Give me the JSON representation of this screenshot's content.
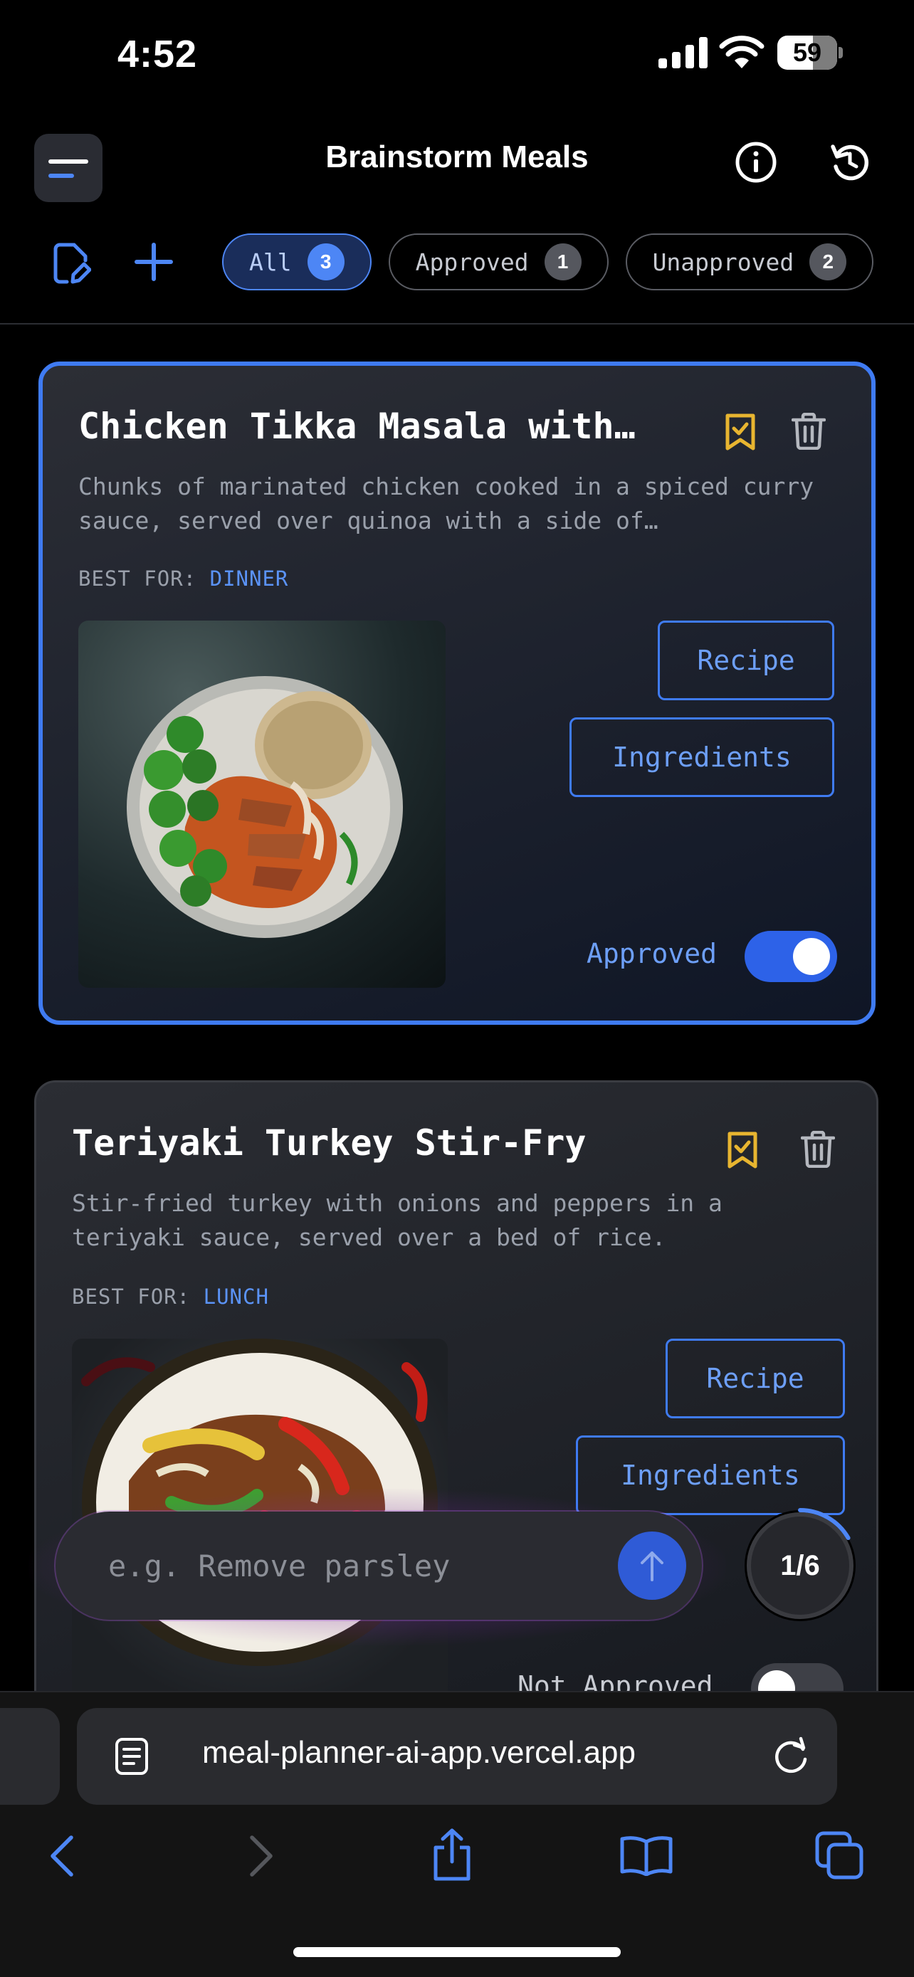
{
  "status_bar": {
    "time": "4:52",
    "battery": "59"
  },
  "header": {
    "title": "Brainstorm Meals"
  },
  "filters": [
    {
      "label": "All",
      "count": "3"
    },
    {
      "label": "Approved",
      "count": "1"
    },
    {
      "label": "Unapproved",
      "count": "2"
    }
  ],
  "meals": [
    {
      "title": "Chicken Tikka Masala with…",
      "description": "Chunks of marinated chicken cooked in a spiced curry sauce, served over quinoa with a side of…",
      "best_for_label": "BEST FOR:",
      "best_for": "DINNER",
      "recipe_label": "Recipe",
      "ingredients_label": "Ingredients",
      "status_label": "Approved",
      "approved": true
    },
    {
      "title": "Teriyaki Turkey Stir-Fry",
      "description": "Stir-fried turkey with onions and peppers in a teriyaki sauce, served over a bed of rice.",
      "best_for_label": "BEST FOR:",
      "best_for": "LUNCH",
      "recipe_label": "Recipe",
      "ingredients_label": "Ingredients",
      "status_label": "Not Approved",
      "approved": false
    }
  ],
  "prompt": {
    "placeholder": "e.g. Remove parsley",
    "value": ""
  },
  "progress": {
    "label": "1/6",
    "current": 1,
    "total": 6
  },
  "browser": {
    "url": "meal-planner-ai-app.vercel.app"
  },
  "colors": {
    "accent": "#3f7bf2",
    "bookmark": "#e8b530",
    "glow": "#aa3cc8"
  }
}
